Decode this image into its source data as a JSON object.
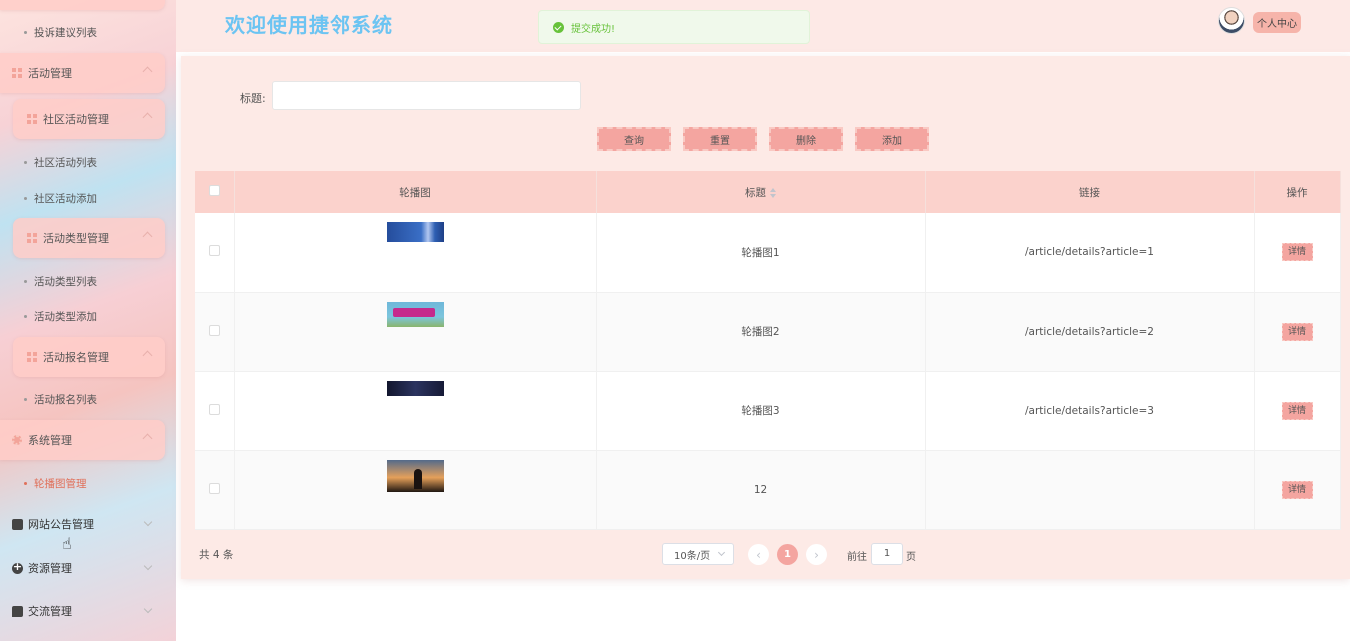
{
  "header": {
    "title": "欢迎使用捷邻系统",
    "toast": "提交成功!",
    "profile_label": "个人中心"
  },
  "sidebar": {
    "complaint_list": "投诉建议列表",
    "activity_group": "活动管理",
    "community_group": "社区活动管理",
    "community_list": "社区活动列表",
    "community_add": "社区活动添加",
    "type_group": "活动类型管理",
    "type_list": "活动类型列表",
    "type_add": "活动类型添加",
    "signup_group": "活动报名管理",
    "signup_list": "活动报名列表",
    "system_group": "系统管理",
    "carousel_item": "轮播图管理",
    "notice_group": "网站公告管理",
    "resource_group": "资源管理",
    "comm_group": "交流管理"
  },
  "search": {
    "title_label": "标题:",
    "title_value": ""
  },
  "toolbar": {
    "query": "查询",
    "reset": "重置",
    "delete": "删除",
    "add": "添加"
  },
  "table": {
    "columns": [
      "轮播图",
      "标题",
      "链接",
      "操作"
    ],
    "detail_label": "详情",
    "rows": [
      {
        "title": "轮播图1",
        "link": "/article/details?article=1"
      },
      {
        "title": "轮播图2",
        "link": "/article/details?article=2"
      },
      {
        "title": "轮播图3",
        "link": "/article/details?article=3"
      },
      {
        "title": "12",
        "link": ""
      }
    ]
  },
  "pagination": {
    "total": "共 4 条",
    "page_size": "10条/页",
    "current_page": "1",
    "goto_label": "前往",
    "goto_value": "1",
    "goto_suffix": "页"
  },
  "colors": {
    "accent": "#f4a5a0",
    "title_blue": "#6cc4f2",
    "success_green": "#67c23a",
    "active_menu": "#e0705a"
  },
  "icons": [
    "grid-icon",
    "gear-icon",
    "document-icon",
    "plus-circle-icon",
    "chat-icon",
    "check-circle-icon",
    "sort-icon",
    "chevron-left-icon",
    "chevron-right-icon"
  ]
}
